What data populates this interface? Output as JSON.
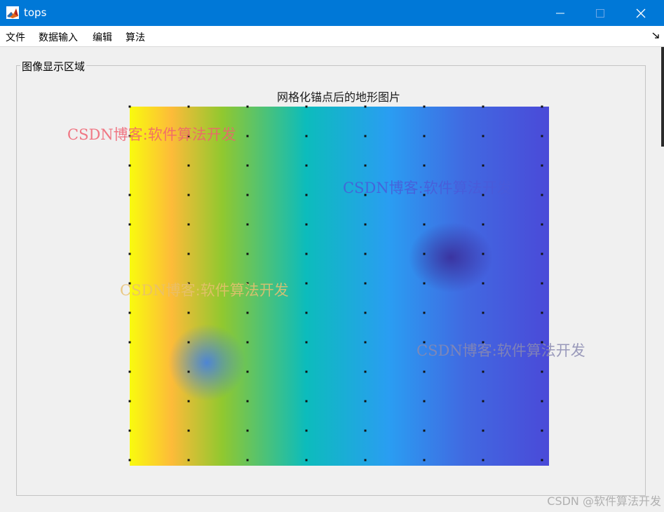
{
  "window": {
    "title": "tops"
  },
  "menu": {
    "items": [
      "文件",
      "数据输入",
      "编辑",
      "算法"
    ]
  },
  "panel": {
    "title": "图像显示区域"
  },
  "figure": {
    "title": "网格化锚点后的地形图片",
    "grid": {
      "columns": 8,
      "rows": 13
    }
  },
  "watermarks": [
    {
      "text": "CSDN博客:软件算法开发",
      "color": "#f06070"
    },
    {
      "text": "CSDN博客:软件算法开发",
      "color": "#4a5ad8"
    },
    {
      "text": "CSDN博客:软件算法开发",
      "color": "#e8c070"
    },
    {
      "text": "CSDN博客:软件算法开发",
      "color": "#8a8ab0"
    }
  ],
  "footer": {
    "watermark": "CSDN @软件算法开发"
  },
  "colors": {
    "titlebar": "#0078d7",
    "colormap": [
      "#f9fb0e",
      "#fdbb39",
      "#91c82f",
      "#0cbcbc",
      "#2a9df2",
      "#4169e1",
      "#4a4ad8"
    ]
  }
}
